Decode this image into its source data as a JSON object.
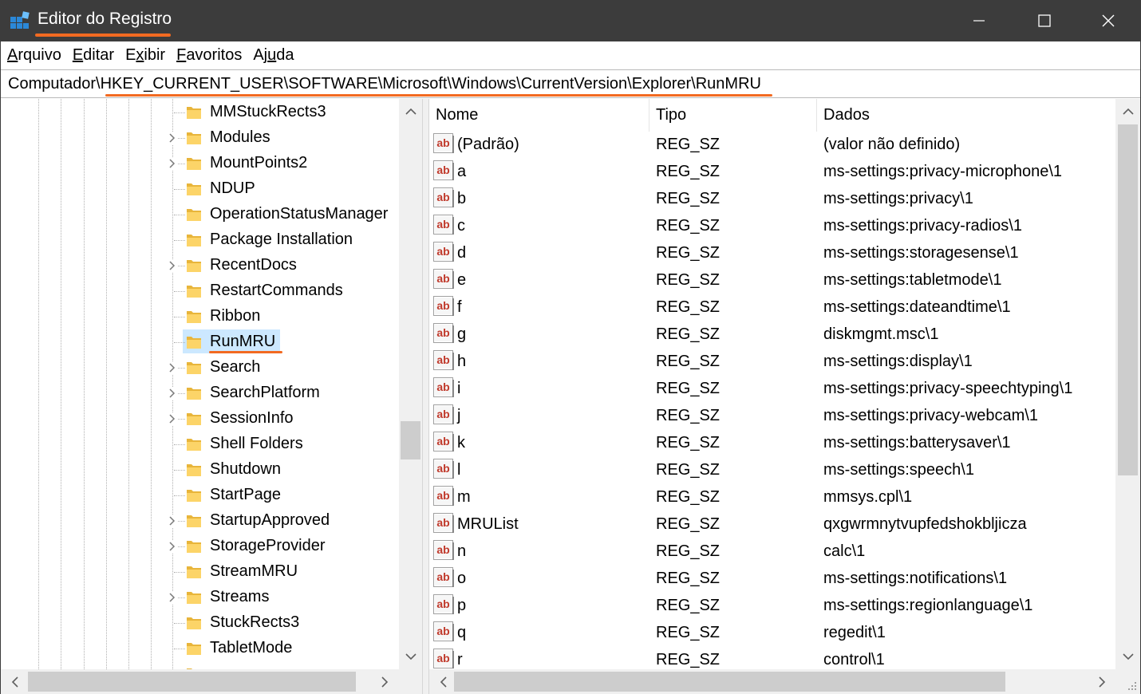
{
  "window": {
    "title": "Editor do Registro",
    "accent_color": "#f26a21",
    "titlebar_color": "#3c3c3c"
  },
  "menu": [
    {
      "label": "Arquivo",
      "mnemonic": "A",
      "rest": "rquivo"
    },
    {
      "label": "Editar",
      "mnemonic": "E",
      "rest": "ditar"
    },
    {
      "label": "Exibir",
      "mnemonic": "x",
      "pre": "E",
      "rest": "ibir"
    },
    {
      "label": "Favoritos",
      "mnemonic": "F",
      "rest": "avoritos"
    },
    {
      "label": "Ajuda",
      "mnemonic": "u",
      "pre": "Aj",
      "rest": "da"
    }
  ],
  "address": {
    "path": "Computador\\HKEY_CURRENT_USER\\SOFTWARE\\Microsoft\\Windows\\CurrentVersion\\Explorer\\RunMRU"
  },
  "tree": {
    "items": [
      {
        "label": "MMStuckRects3",
        "expandable": false
      },
      {
        "label": "Modules",
        "expandable": true
      },
      {
        "label": "MountPoints2",
        "expandable": true
      },
      {
        "label": "NDUP",
        "expandable": false
      },
      {
        "label": "OperationStatusManager",
        "expandable": false
      },
      {
        "label": "Package Installation",
        "expandable": false
      },
      {
        "label": "RecentDocs",
        "expandable": true
      },
      {
        "label": "RestartCommands",
        "expandable": false
      },
      {
        "label": "Ribbon",
        "expandable": false
      },
      {
        "label": "RunMRU",
        "expandable": false,
        "selected": true
      },
      {
        "label": "Search",
        "expandable": true
      },
      {
        "label": "SearchPlatform",
        "expandable": true
      },
      {
        "label": "SessionInfo",
        "expandable": true
      },
      {
        "label": "Shell Folders",
        "expandable": false
      },
      {
        "label": "Shutdown",
        "expandable": false
      },
      {
        "label": "StartPage",
        "expandable": false
      },
      {
        "label": "StartupApproved",
        "expandable": true
      },
      {
        "label": "StorageProvider",
        "expandable": true
      },
      {
        "label": "StreamMRU",
        "expandable": false
      },
      {
        "label": "Streams",
        "expandable": true
      },
      {
        "label": "StuckRects3",
        "expandable": false
      },
      {
        "label": "TabletMode",
        "expandable": false
      },
      {
        "label": "",
        "expandable": false
      }
    ]
  },
  "values": {
    "columns": [
      "Nome",
      "Tipo",
      "Dados"
    ],
    "rows": [
      {
        "name": "(Padrão)",
        "type": "REG_SZ",
        "data": "(valor não definido)"
      },
      {
        "name": "a",
        "type": "REG_SZ",
        "data": "ms-settings:privacy-microphone\\1"
      },
      {
        "name": "b",
        "type": "REG_SZ",
        "data": "ms-settings:privacy\\1"
      },
      {
        "name": "c",
        "type": "REG_SZ",
        "data": "ms-settings:privacy-radios\\1"
      },
      {
        "name": "d",
        "type": "REG_SZ",
        "data": "ms-settings:storagesense\\1"
      },
      {
        "name": "e",
        "type": "REG_SZ",
        "data": "ms-settings:tabletmode\\1"
      },
      {
        "name": "f",
        "type": "REG_SZ",
        "data": "ms-settings:dateandtime\\1"
      },
      {
        "name": "g",
        "type": "REG_SZ",
        "data": "diskmgmt.msc\\1"
      },
      {
        "name": "h",
        "type": "REG_SZ",
        "data": "ms-settings:display\\1"
      },
      {
        "name": "i",
        "type": "REG_SZ",
        "data": "ms-settings:privacy-speechtyping\\1"
      },
      {
        "name": "j",
        "type": "REG_SZ",
        "data": "ms-settings:privacy-webcam\\1"
      },
      {
        "name": "k",
        "type": "REG_SZ",
        "data": "ms-settings:batterysaver\\1"
      },
      {
        "name": "l",
        "type": "REG_SZ",
        "data": "ms-settings:speech\\1"
      },
      {
        "name": "m",
        "type": "REG_SZ",
        "data": "mmsys.cpl\\1"
      },
      {
        "name": "MRUList",
        "type": "REG_SZ",
        "data": "qxgwrmnytvupfedshokbljicza"
      },
      {
        "name": "n",
        "type": "REG_SZ",
        "data": "calc\\1"
      },
      {
        "name": "o",
        "type": "REG_SZ",
        "data": "ms-settings:notifications\\1"
      },
      {
        "name": "p",
        "type": "REG_SZ",
        "data": "ms-settings:regionlanguage\\1"
      },
      {
        "name": "q",
        "type": "REG_SZ",
        "data": "regedit\\1"
      },
      {
        "name": "r",
        "type": "REG_SZ",
        "data": "control\\1"
      }
    ]
  }
}
